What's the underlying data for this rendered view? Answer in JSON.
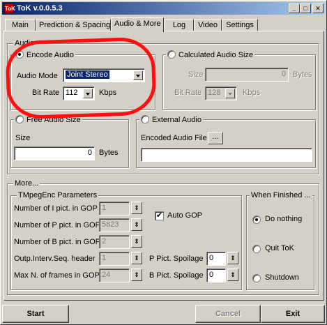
{
  "window": {
    "title": "ToK v.0.0.5.3",
    "app_icon_text": "ToK"
  },
  "tabs": [
    "Main",
    "Prediction & Spacing",
    "Audio & More",
    "Log",
    "Video",
    "Settings"
  ],
  "active_tab": "Audio & More",
  "audio": {
    "section_title": "Audio",
    "encode_audio_label": "Encode Audio",
    "audio_mode_label": "Audio Mode",
    "audio_mode_value": "Joint Stereo",
    "bit_rate_label": "Bit Rate",
    "bit_rate_value": "112",
    "kbps_label": "Kbps",
    "calculated_label": "Calculated Audio Size",
    "size_label": "Size",
    "calc_size_value": "0",
    "bytes_label": "Bytes",
    "calc_bit_rate_label": "Bit Rate",
    "calc_bit_rate_value": "128",
    "calc_kbps_label": "Kbps",
    "free_size_label": "Free Audio Size",
    "free_size_size_label": "Size",
    "free_size_value": "0",
    "free_bytes_label": "Bytes",
    "external_label": "External Audio",
    "encoded_file_label": "Encoded Audio File",
    "browse_label": "...",
    "encoded_file_value": ""
  },
  "more": {
    "section_title": "More...",
    "tmpeg_title": "TMpegEnc Parameters",
    "params": [
      {
        "label": "Number of I pict. in GOP",
        "value": "1"
      },
      {
        "label": "Number of P pict. in GOP",
        "value": "5823"
      },
      {
        "label": "Number of B pict. in GOP",
        "value": "2"
      },
      {
        "label": "Outp.Interv.Seq. header",
        "value": "1"
      },
      {
        "label": "Max N. of frames in GOP",
        "value": "24"
      }
    ],
    "auto_gop_label": "Auto GOP",
    "auto_gop_checked": "✔",
    "p_spoilage_label": "P Pict. Spoilage",
    "p_spoilage_value": "0",
    "b_spoilage_label": "B Pict. Spoilage",
    "b_spoilage_value": "0",
    "when_finished_title": "When Finished ...",
    "do_nothing_label": "Do nothing",
    "quit_label": "Quit ToK",
    "shutdown_label": "Shutdown"
  },
  "buttons": {
    "start": "Start",
    "cancel": "Cancel",
    "exit": "Exit"
  },
  "colors": {
    "face": "#d4d0c8",
    "titlebar_start": "#0a246a",
    "titlebar_end": "#a6caf0",
    "annotation_ring": "#ff1010"
  }
}
